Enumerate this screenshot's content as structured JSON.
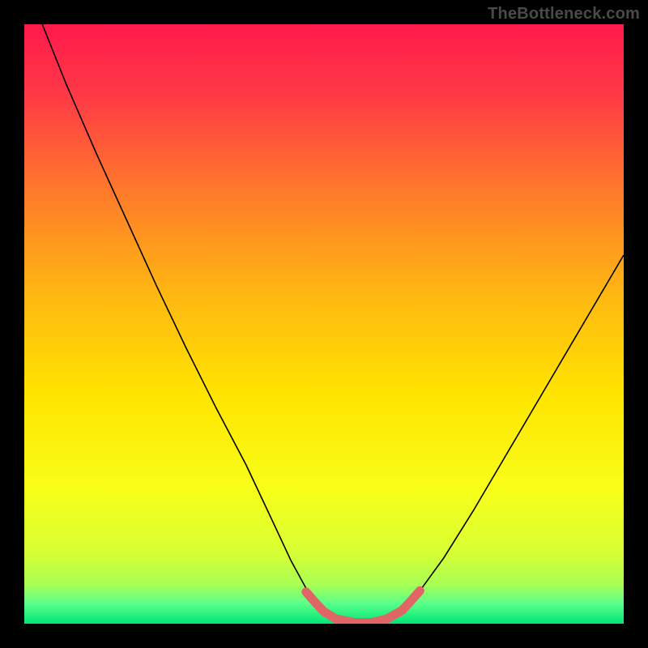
{
  "watermark": "TheBottleneck.com",
  "chart_data": {
    "type": "line",
    "title": "",
    "xlabel": "",
    "ylabel": "",
    "xlim": [
      0,
      100
    ],
    "ylim": [
      0,
      100
    ],
    "grid": false,
    "legend": false,
    "background_gradient": [
      {
        "offset": 0.0,
        "color": "#ff1a4b"
      },
      {
        "offset": 0.12,
        "color": "#ff3a46"
      },
      {
        "offset": 0.28,
        "color": "#ff7a2a"
      },
      {
        "offset": 0.45,
        "color": "#ffb712"
      },
      {
        "offset": 0.62,
        "color": "#ffe500"
      },
      {
        "offset": 0.78,
        "color": "#f7ff1a"
      },
      {
        "offset": 0.88,
        "color": "#d8ff33"
      },
      {
        "offset": 0.935,
        "color": "#a8ff55"
      },
      {
        "offset": 0.965,
        "color": "#5eff8a"
      },
      {
        "offset": 1.0,
        "color": "#00e676"
      }
    ],
    "series": [
      {
        "name": "bottleneck-curve",
        "stroke": "#000000",
        "stroke_width": 1.6,
        "points": [
          {
            "x": 3.0,
            "y": 100.0
          },
          {
            "x": 7.0,
            "y": 90.0
          },
          {
            "x": 12.0,
            "y": 78.5
          },
          {
            "x": 17.0,
            "y": 67.5
          },
          {
            "x": 22.0,
            "y": 56.5
          },
          {
            "x": 27.0,
            "y": 46.0
          },
          {
            "x": 32.0,
            "y": 36.0
          },
          {
            "x": 37.0,
            "y": 26.5
          },
          {
            "x": 41.0,
            "y": 18.0
          },
          {
            "x": 44.5,
            "y": 10.5
          },
          {
            "x": 47.5,
            "y": 5.0
          },
          {
            "x": 50.0,
            "y": 2.0
          },
          {
            "x": 52.0,
            "y": 0.6
          },
          {
            "x": 55.0,
            "y": 0.0
          },
          {
            "x": 58.0,
            "y": 0.0
          },
          {
            "x": 60.5,
            "y": 0.6
          },
          {
            "x": 63.0,
            "y": 2.2
          },
          {
            "x": 66.0,
            "y": 5.5
          },
          {
            "x": 70.0,
            "y": 11.0
          },
          {
            "x": 75.0,
            "y": 19.0
          },
          {
            "x": 80.0,
            "y": 27.5
          },
          {
            "x": 85.0,
            "y": 36.0
          },
          {
            "x": 90.0,
            "y": 44.5
          },
          {
            "x": 95.0,
            "y": 53.0
          },
          {
            "x": 100.0,
            "y": 61.5
          }
        ]
      },
      {
        "name": "optimal-zone-highlight",
        "stroke": "#e06666",
        "stroke_width": 11,
        "linecap": "round",
        "points": [
          {
            "x": 47.0,
            "y": 5.3
          },
          {
            "x": 48.5,
            "y": 3.6
          },
          {
            "x": 50.0,
            "y": 2.0
          },
          {
            "x": 52.0,
            "y": 0.8
          },
          {
            "x": 55.0,
            "y": 0.2
          },
          {
            "x": 58.0,
            "y": 0.2
          },
          {
            "x": 60.5,
            "y": 0.8
          },
          {
            "x": 63.0,
            "y": 2.2
          },
          {
            "x": 64.5,
            "y": 3.8
          },
          {
            "x": 66.0,
            "y": 5.5
          }
        ]
      }
    ]
  }
}
